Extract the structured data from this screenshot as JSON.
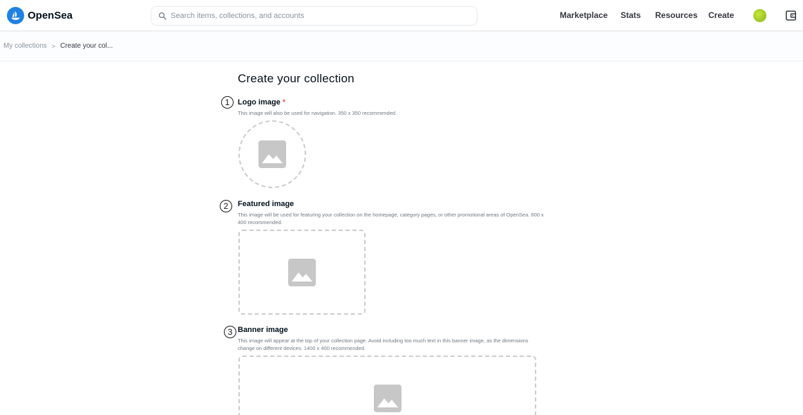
{
  "brand": {
    "name": "OpenSea",
    "accent": "#2081e2"
  },
  "search": {
    "placeholder": "Search items, collections, and accounts",
    "value": ""
  },
  "nav": {
    "items": [
      {
        "label": "Marketplace"
      },
      {
        "label": "Stats"
      },
      {
        "label": "Resources"
      },
      {
        "label": "Create"
      }
    ]
  },
  "breadcrumb": {
    "parent": "My collections",
    "separator": ">",
    "current": "Create your col..."
  },
  "page": {
    "title": "Create your collection"
  },
  "fields": [
    {
      "step": "1",
      "label": "Logo image",
      "required_mark": "*",
      "description": "This image will also be used for navigation. 350 x 350 recommended."
    },
    {
      "step": "2",
      "label": "Featured image",
      "description": "This image will be used for featuring your collection on the homepage, category pages, or other promotional areas of OpenSea. 600 x 400 recommended."
    },
    {
      "step": "3",
      "label": "Banner image",
      "description": "This image will appear at the top of your collection page. Avoid including too much text in this banner image, as the dimensions change on different devices. 1400 x 400 recommended."
    }
  ],
  "icons": {
    "logo": "opensea-logo-icon",
    "search": "search-icon",
    "avatar": "avatar",
    "wallet": "wallet-icon",
    "image_placeholder": "image-placeholder-icon"
  }
}
